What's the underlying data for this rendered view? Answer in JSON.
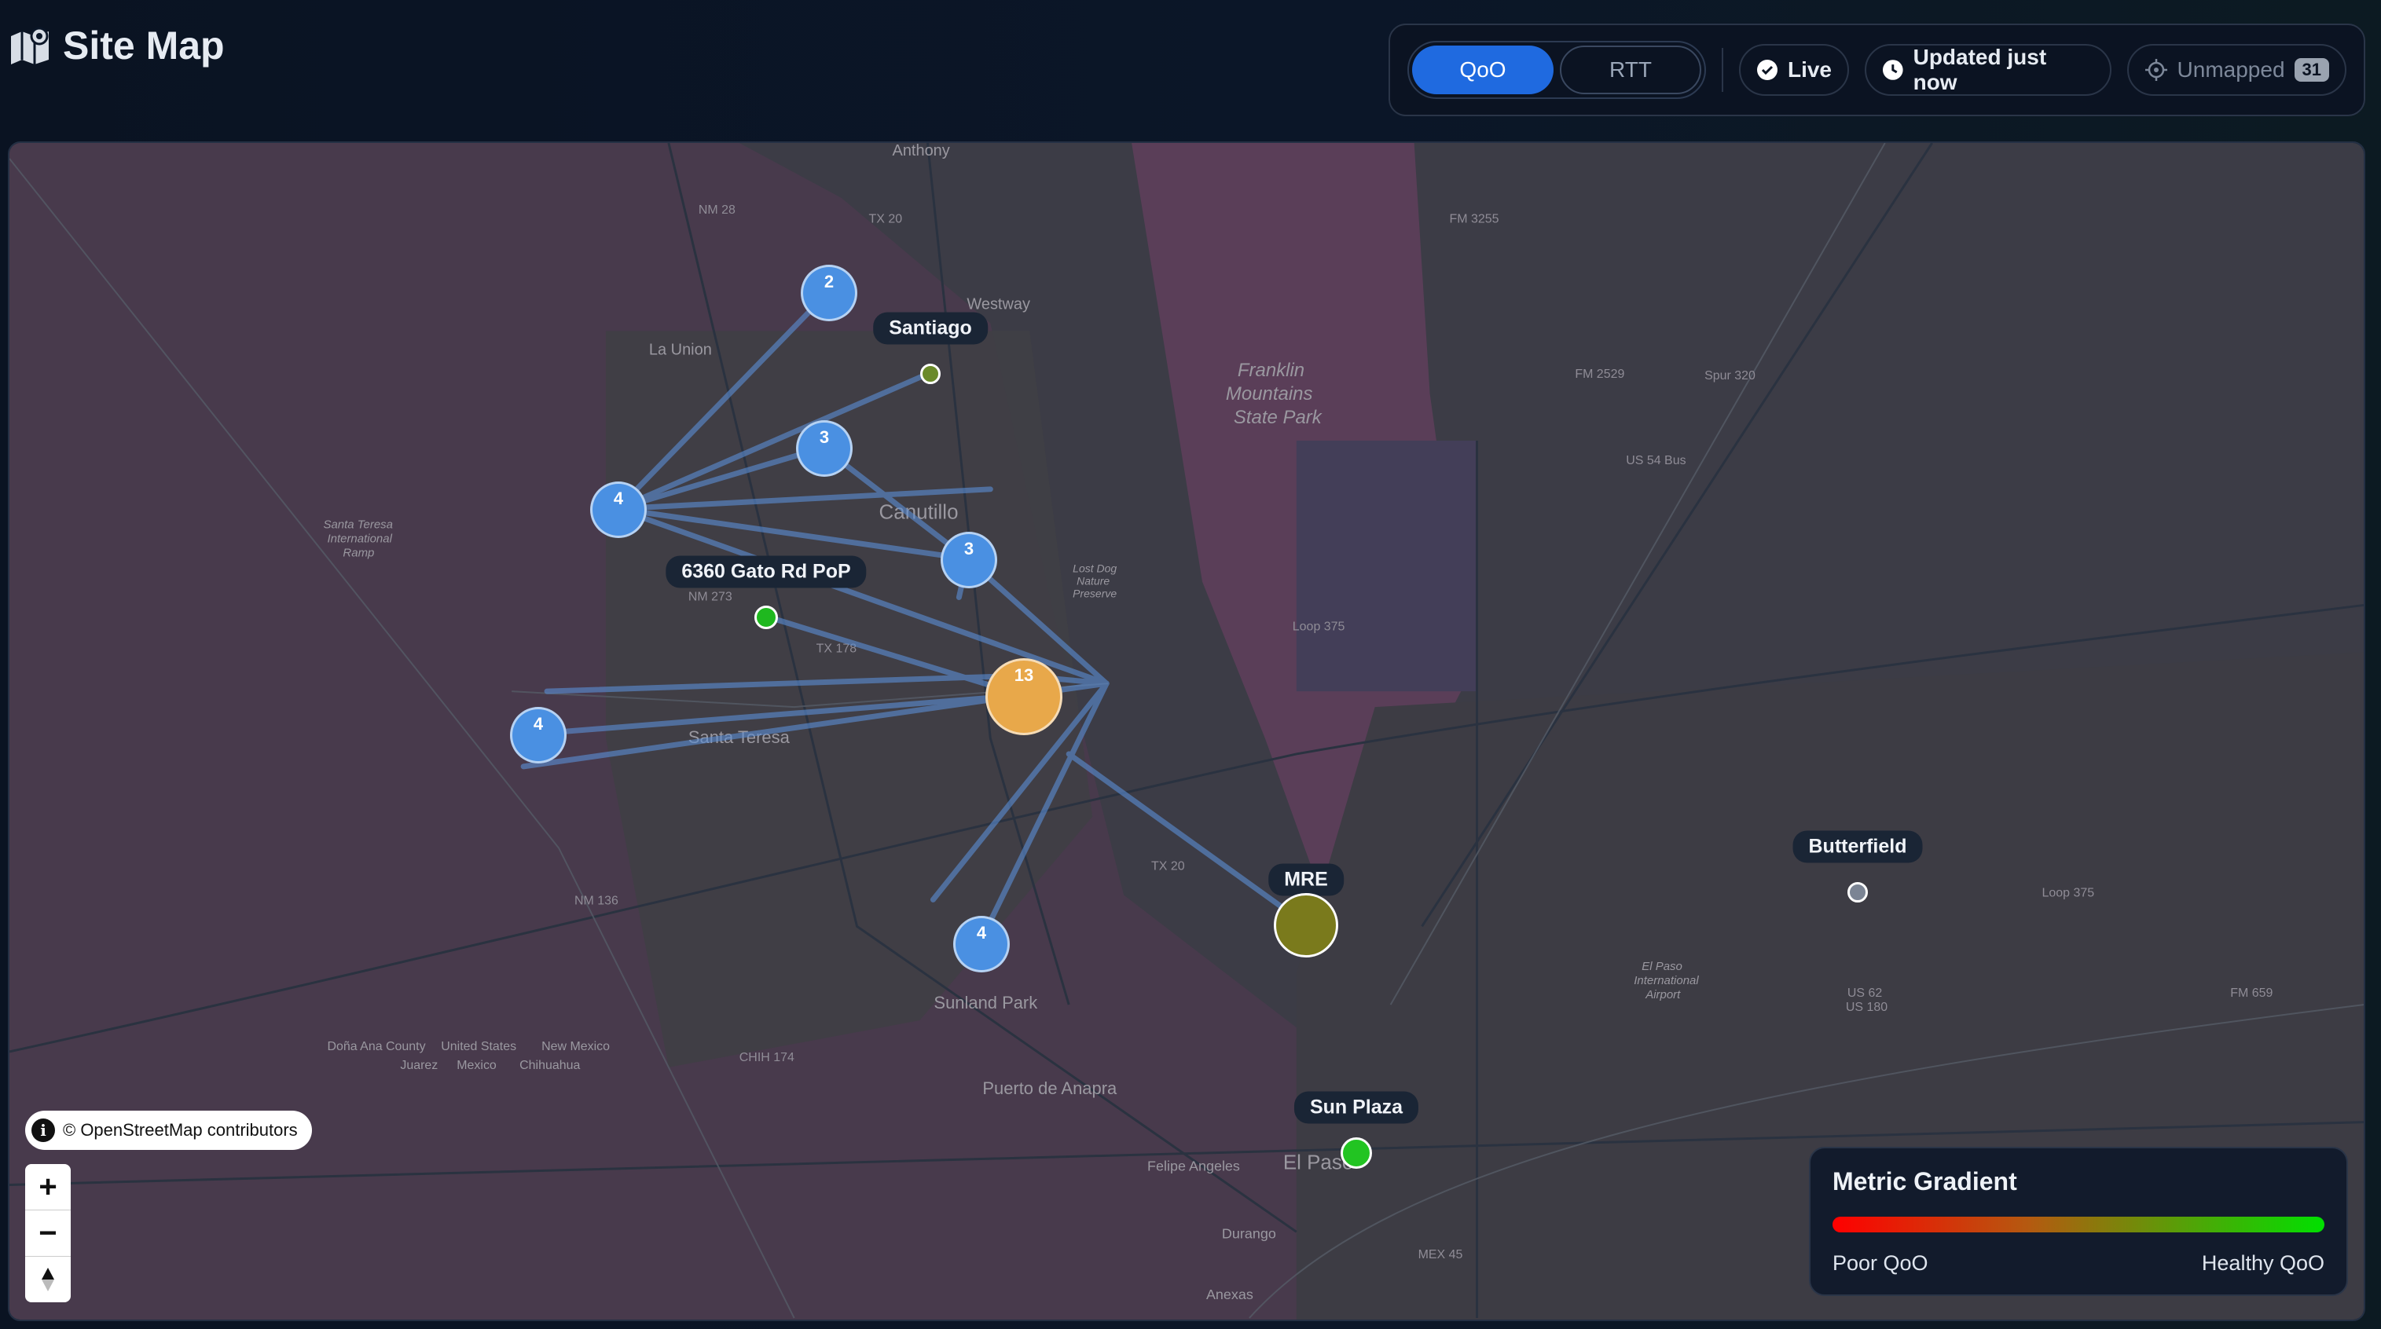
{
  "header": {
    "title": "Site Map",
    "icon": "map-icon"
  },
  "toolbar": {
    "metric_options": [
      "QoO",
      "RTT"
    ],
    "selected_metric": "QoO",
    "live_label": "Live",
    "updated_label": "Updated just now",
    "unmapped_label": "Unmapped",
    "unmapped_count": "31"
  },
  "map": {
    "attribution": "© OpenStreetMap contributors",
    "place_names": {
      "anthony": "Anthony",
      "westway": "Westway",
      "la_union": "La Union",
      "franklin": "Franklin",
      "mountains": "Mountains",
      "state_park": "State Park",
      "canutillo": "Canutillo",
      "santa_teresa": "Santa Teresa",
      "sunland_park": "Sunland Park",
      "puerto_de_anapra": "Puerto de Anapra",
      "felipe_angeles": "Felipe Angeles",
      "el_paso": "El Paso",
      "durango": "Durango",
      "anexas": "Anexas",
      "dona_ana_county": "Doña Ana County",
      "united_states": "United States",
      "new_mexico": "New Mexico",
      "juarez": "Juarez",
      "mexico": "Mexico",
      "chihuahua": "Chihuahua",
      "santa_teresa_airport_1": "Santa Teresa",
      "santa_teresa_airport_2": "International",
      "santa_teresa_airport_3": "Ramp",
      "el_paso_airport_1": "El Paso",
      "el_paso_airport_2": "International",
      "el_paso_airport_3": "Airport",
      "nature_preserve_1": "Lost Dog",
      "nature_preserve_2": "Nature",
      "nature_preserve_3": "Preserve"
    },
    "road_labels": {
      "nm28": "NM 28",
      "tx20_n": "TX 20",
      "fm3255": "FM 3255",
      "fm2529": "FM 2529",
      "spur320": "Spur 320",
      "us54bus": "US 54 Bus",
      "nm273": "NM 273",
      "tx178": "TX 178",
      "loop375": "Loop 375",
      "tx20_s": "TX 20",
      "nm136": "NM 136",
      "chih174": "CHIH 174",
      "loop375_e": "Loop 375",
      "us62": "US 62",
      "us180": "US 180",
      "fm659": "FM 659",
      "mex45": "MEX 45"
    },
    "clusters": [
      {
        "count": "2",
        "color": "#4a90e2"
      },
      {
        "count": "3",
        "color": "#4a90e2"
      },
      {
        "count": "4",
        "color": "#4a90e2"
      },
      {
        "count": "3",
        "color": "#4a90e2"
      },
      {
        "count": "13",
        "color": "#e8a84a"
      },
      {
        "count": "4",
        "color": "#4a90e2"
      },
      {
        "count": "4",
        "color": "#4a90e2"
      }
    ],
    "sites": [
      {
        "name": "Santiago",
        "color": "#6a8a2a"
      },
      {
        "name": "6360 Gato Rd PoP",
        "color": "#1fb81f"
      },
      {
        "name": "MRE",
        "color": "#7a7a1c"
      },
      {
        "name": "Butterfield",
        "color": "#7b8494"
      },
      {
        "name": "Sun Plaza",
        "color": "#22c422"
      }
    ]
  },
  "legend": {
    "title": "Metric Gradient",
    "low_label": "Poor QoO",
    "high_label": "Healthy QoO",
    "gradient_colors": [
      "#ff0000",
      "#00e000"
    ]
  }
}
